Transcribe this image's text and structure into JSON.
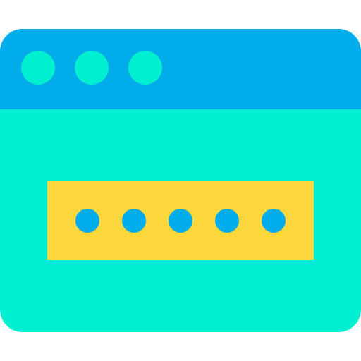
{
  "icon": {
    "name": "browser-password-icon",
    "colors": {
      "titlebar": "#00ACEA",
      "window_body": "#00EFD1",
      "window_dots": "#00EFD1",
      "password_field": "#FDD83C",
      "password_mask_dots": "#00ACEA"
    },
    "window_control_dots": 3,
    "password_mask_length": 5
  }
}
